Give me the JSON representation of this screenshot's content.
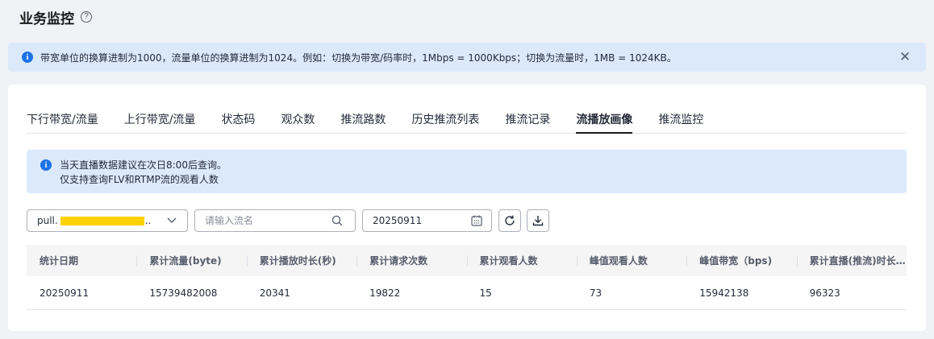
{
  "header": {
    "title": "业务监控",
    "help_glyph": "?"
  },
  "top_notice": {
    "text": "带宽单位的换算进制为1000，流量单位的换算进制为1024。例如：切换为带宽/码率时，1Mbps = 1000Kbps；切换为流量时，1MB = 1024KB。",
    "close_glyph": "✕"
  },
  "tabs": [
    {
      "label": "下行带宽/流量"
    },
    {
      "label": "上行带宽/流量"
    },
    {
      "label": "状态码"
    },
    {
      "label": "观众数"
    },
    {
      "label": "推流路数"
    },
    {
      "label": "历史推流列表"
    },
    {
      "label": "推流记录"
    },
    {
      "label": "流播放画像",
      "active": true
    },
    {
      "label": "推流监控"
    }
  ],
  "inner_notice": {
    "line1": "当天直播数据建议在次日8:00后查询。",
    "line2": "仅支持查询FLV和RTMP流的观看人数"
  },
  "filters": {
    "domain_select_prefix": "pull.",
    "domain_select_suffix": "..",
    "stream_placeholder": "请输入流名",
    "date_value": "20250911"
  },
  "table": {
    "columns": [
      "统计日期",
      "累计流量(byte)",
      "累计播放时长(秒)",
      "累计请求次数",
      "累计观看人数",
      "峰值观看人数",
      "峰值带宽（bps)",
      "累计直播(推流)时长(秒)"
    ],
    "rows": [
      [
        "20250911",
        "15739482008",
        "20341",
        "19822",
        "15",
        "73",
        "15942138",
        "96323"
      ]
    ]
  },
  "colors": {
    "accent": "#1d73e6",
    "notice_bg": "#dbe9fb",
    "redaction": "#ffd200"
  }
}
